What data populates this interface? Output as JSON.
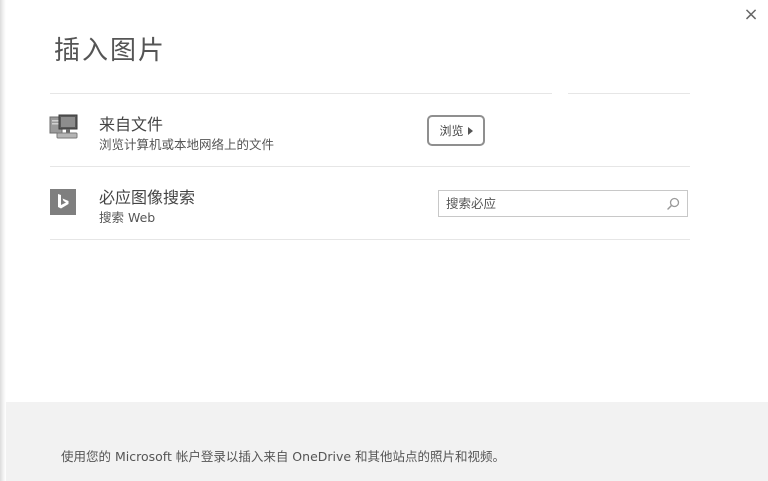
{
  "dialog": {
    "title": "插入图片",
    "close_label": "×"
  },
  "from_file": {
    "title": "来自文件",
    "description": "浏览计算机或本地网络上的文件",
    "browse_label": "浏览",
    "icon": "computer-icon"
  },
  "bing_search": {
    "title": "必应图像搜索",
    "description": "搜索 Web",
    "search_placeholder": "搜索必应",
    "icon": "bing-logo-icon"
  },
  "footer": {
    "text": "使用您的 Microsoft 帐户登录以插入来自 OneDrive 和其他站点的照片和视频。"
  }
}
